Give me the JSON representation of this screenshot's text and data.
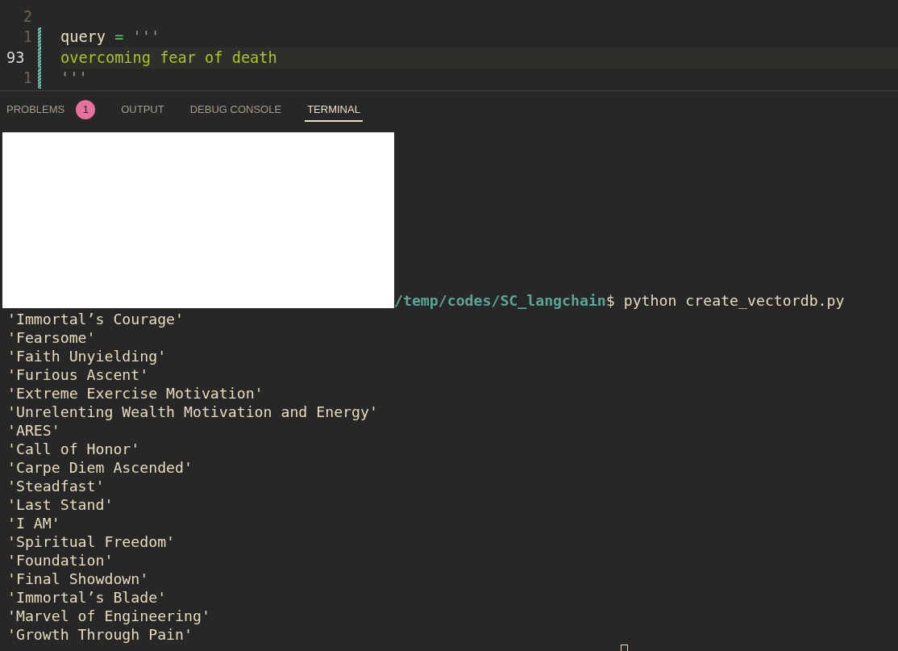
{
  "editor": {
    "lines": [
      {
        "number": "2",
        "current": false,
        "modified": false
      },
      {
        "number": "1",
        "current": false,
        "modified": true,
        "tokens": [
          {
            "kind": "variable",
            "text": "query"
          },
          {
            "kind": "operator",
            "text": "="
          },
          {
            "kind": "string_delim",
            "text": "'''"
          }
        ]
      },
      {
        "number": "93",
        "current": true,
        "modified": true,
        "tokens": [
          {
            "kind": "string",
            "text": "overcoming fear of death"
          }
        ]
      },
      {
        "number": "1",
        "current": false,
        "modified": true,
        "tokens": [
          {
            "kind": "string_delim",
            "text": "'''"
          }
        ]
      }
    ]
  },
  "panel": {
    "tabs": [
      {
        "label": "PROBLEMS",
        "badge": "1",
        "selected": false
      },
      {
        "label": "OUTPUT",
        "selected": false
      },
      {
        "label": "DEBUG CONSOLE",
        "selected": false
      },
      {
        "label": "TERMINAL",
        "selected": true
      }
    ]
  },
  "terminal": {
    "prompt_path": "/temp/codes/SC_langchain",
    "command": "$ python create_vectordb.py",
    "output": [
      "'Immortal’s Courage'",
      "'Fearsome'",
      "'Faith Unyielding'",
      "'Furious Ascent'",
      "'Extreme Exercise Motivation'",
      "'Unrelenting Wealth Motivation and Energy'",
      "'ARES'",
      "'Call of Honor'",
      "'Carpe Diem Ascended'",
      "'Steadfast'",
      "'Last Stand'",
      "'I AM'",
      "'Spiritual Freedom'",
      "'Foundation'",
      "'Final Showdown'",
      "'Immortal’s Blade'",
      "'Marvel of Engineering'",
      "'Growth Through Pain'"
    ]
  }
}
